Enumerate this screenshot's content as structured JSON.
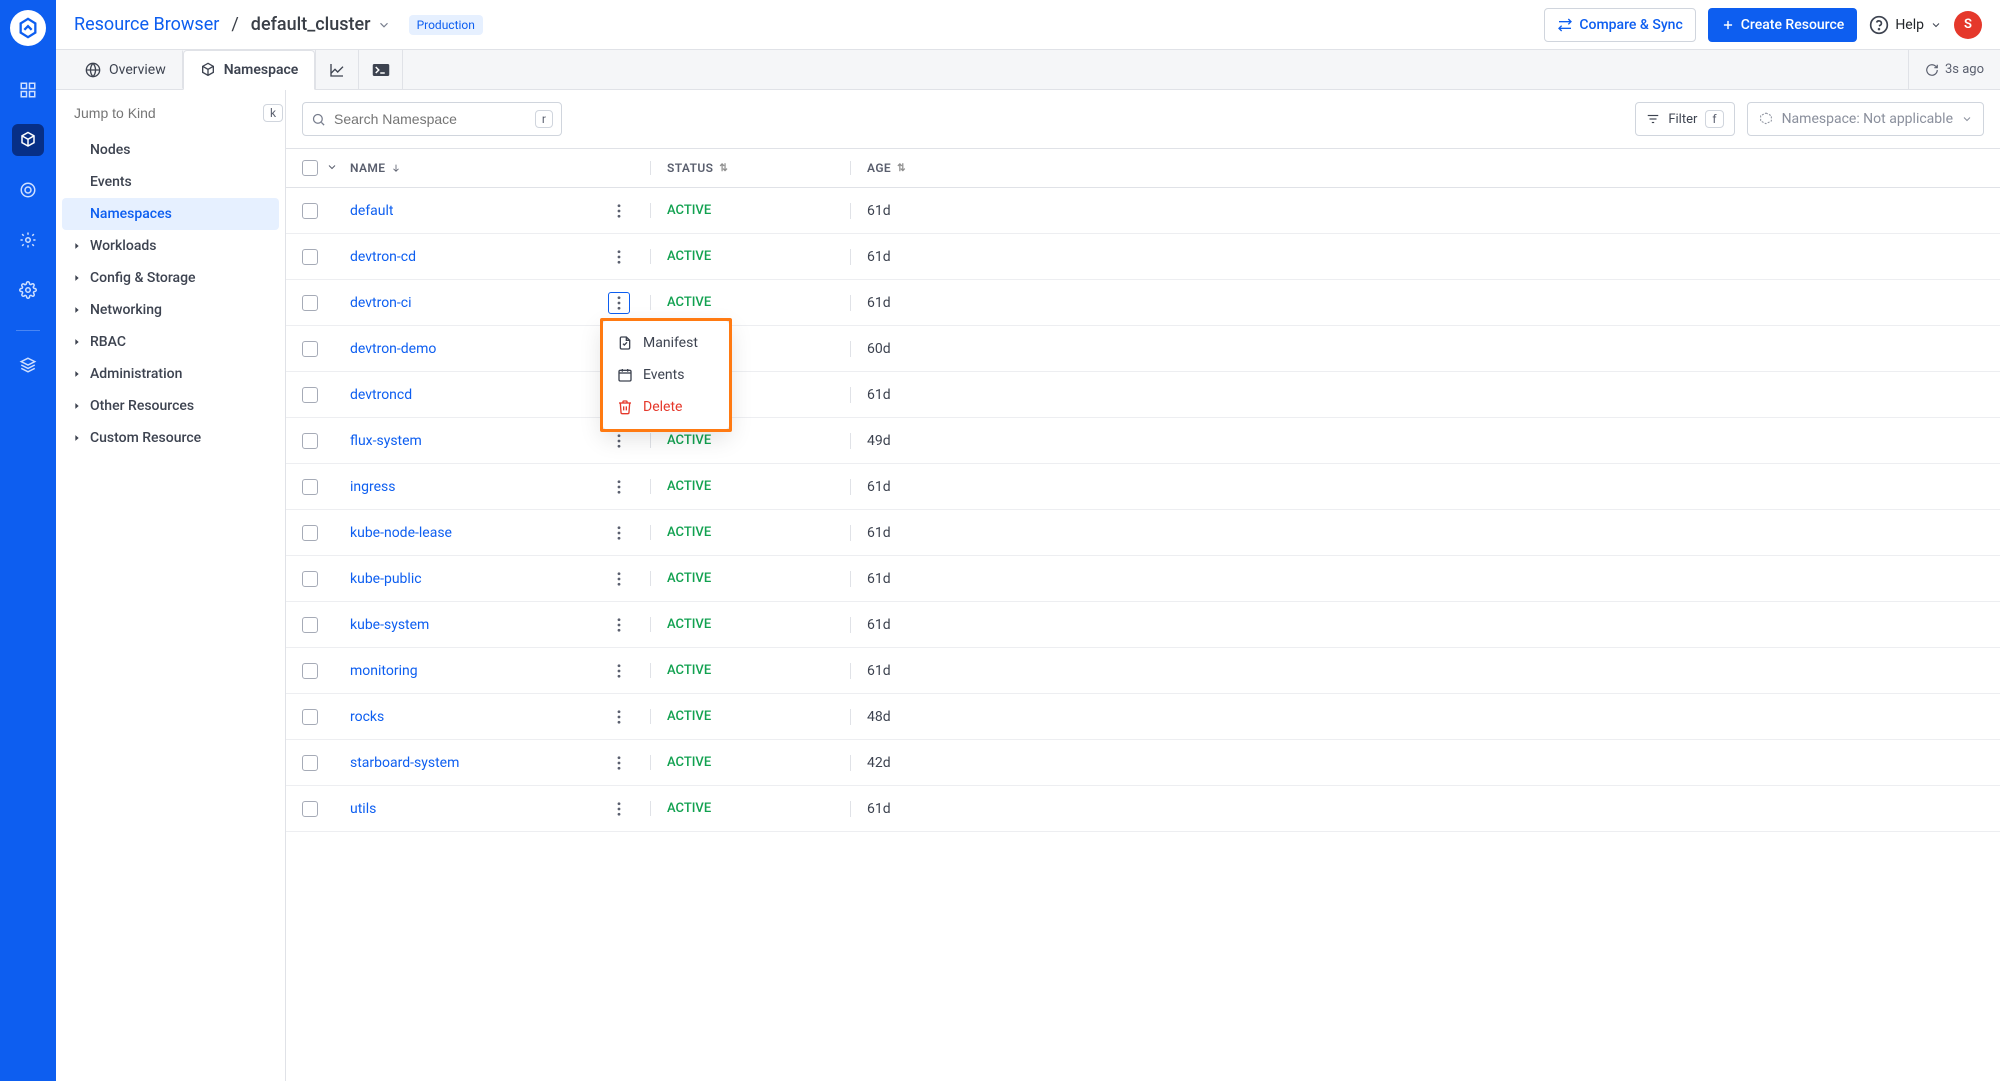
{
  "breadcrumb": {
    "root": "Resource Browser",
    "cluster": "default_cluster",
    "env_chip": "Production"
  },
  "header": {
    "compare_btn": "Compare & Sync",
    "create_btn": "Create Resource",
    "help": "Help",
    "avatar_initial": "S"
  },
  "tabbar": {
    "overview": "Overview",
    "namespace": "Namespace",
    "refresh_label": "3s ago"
  },
  "sidebar": {
    "jump_placeholder": "Jump to Kind",
    "jump_key": "k",
    "items": [
      "Nodes",
      "Events",
      "Namespaces"
    ],
    "groups": [
      "Workloads",
      "Config & Storage",
      "Networking",
      "RBAC",
      "Administration",
      "Other Resources",
      "Custom Resource"
    ],
    "selected": "Namespaces"
  },
  "filterbar": {
    "search_placeholder": "Search Namespace",
    "search_key": "r",
    "filter_btn": "Filter",
    "filter_key": "f",
    "ns_label": "Namespace: Not applicable"
  },
  "table": {
    "headers": {
      "name": "NAME",
      "status": "STATUS",
      "age": "AGE"
    },
    "rows": [
      {
        "name": "default",
        "status": "ACTIVE",
        "age": "61d",
        "menu_open": false
      },
      {
        "name": "devtron-cd",
        "status": "ACTIVE",
        "age": "61d",
        "menu_open": false
      },
      {
        "name": "devtron-ci",
        "status": "ACTIVE",
        "age": "61d",
        "menu_open": true
      },
      {
        "name": "devtron-demo",
        "status": "",
        "age": "60d",
        "menu_open": false
      },
      {
        "name": "devtroncd",
        "status": "",
        "age": "61d",
        "menu_open": false
      },
      {
        "name": "flux-system",
        "status": "ACTIVE",
        "age": "49d",
        "menu_open": false
      },
      {
        "name": "ingress",
        "status": "ACTIVE",
        "age": "61d",
        "menu_open": false
      },
      {
        "name": "kube-node-lease",
        "status": "ACTIVE",
        "age": "61d",
        "menu_open": false
      },
      {
        "name": "kube-public",
        "status": "ACTIVE",
        "age": "61d",
        "menu_open": false
      },
      {
        "name": "kube-system",
        "status": "ACTIVE",
        "age": "61d",
        "menu_open": false
      },
      {
        "name": "monitoring",
        "status": "ACTIVE",
        "age": "61d",
        "menu_open": false
      },
      {
        "name": "rocks",
        "status": "ACTIVE",
        "age": "48d",
        "menu_open": false
      },
      {
        "name": "starboard-system",
        "status": "ACTIVE",
        "age": "42d",
        "menu_open": false
      },
      {
        "name": "utils",
        "status": "ACTIVE",
        "age": "61d",
        "menu_open": false
      }
    ]
  },
  "context_menu": {
    "items": [
      {
        "label": "Manifest",
        "icon": "file-icon",
        "danger": false
      },
      {
        "label": "Events",
        "icon": "calendar-icon",
        "danger": false
      },
      {
        "label": "Delete",
        "icon": "trash-icon",
        "danger": true
      }
    ]
  }
}
